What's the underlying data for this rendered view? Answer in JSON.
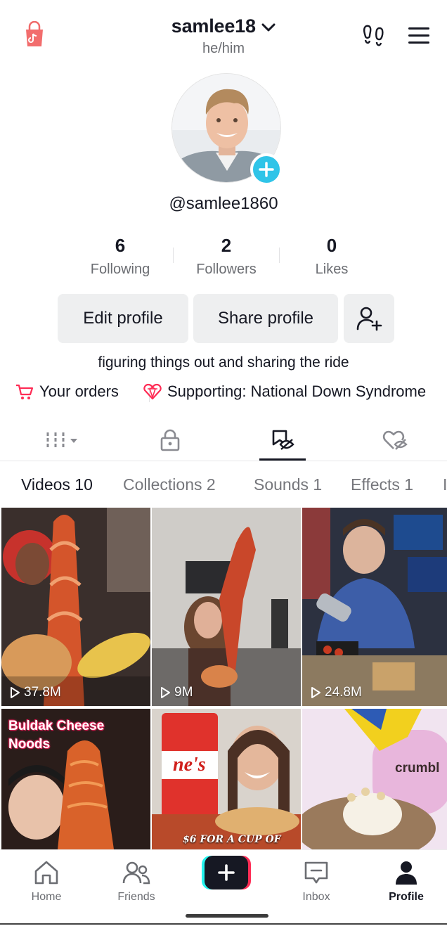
{
  "header": {
    "username": "samlee18",
    "pronouns": "he/him"
  },
  "profile": {
    "handle": "@samlee1860",
    "bio": "figuring things out and sharing the ride"
  },
  "stats": [
    {
      "value": "6",
      "label": "Following"
    },
    {
      "value": "2",
      "label": "Followers"
    },
    {
      "value": "0",
      "label": "Likes"
    }
  ],
  "actions": {
    "edit_label": "Edit profile",
    "share_label": "Share profile"
  },
  "links": {
    "orders": "Your orders",
    "supporting": "Supporting: National Down Syndrome"
  },
  "subtabs": [
    "Videos 10",
    "Collections 2",
    "Sounds 1",
    "Effects 1"
  ],
  "videos": [
    {
      "views": "37.8M"
    },
    {
      "views": "9M"
    },
    {
      "views": "24.8M"
    },
    {
      "overlay": "Buldak Cheese Noods",
      "overlay_lines": [
        "Buldak Cheese",
        "Noods"
      ]
    },
    {
      "overlay": "$6 FOR A CUP OF"
    },
    {
      "overlay": "crumbl"
    }
  ],
  "nav": {
    "home": "Home",
    "friends": "Friends",
    "inbox": "Inbox",
    "profile": "Profile"
  },
  "colors": {
    "accent_cyan": "#2fc4e8",
    "brand_red": "#fe2c55",
    "text_primary": "#161823",
    "text_secondary": "#6b6d72",
    "button_bg": "#eeeff0"
  }
}
